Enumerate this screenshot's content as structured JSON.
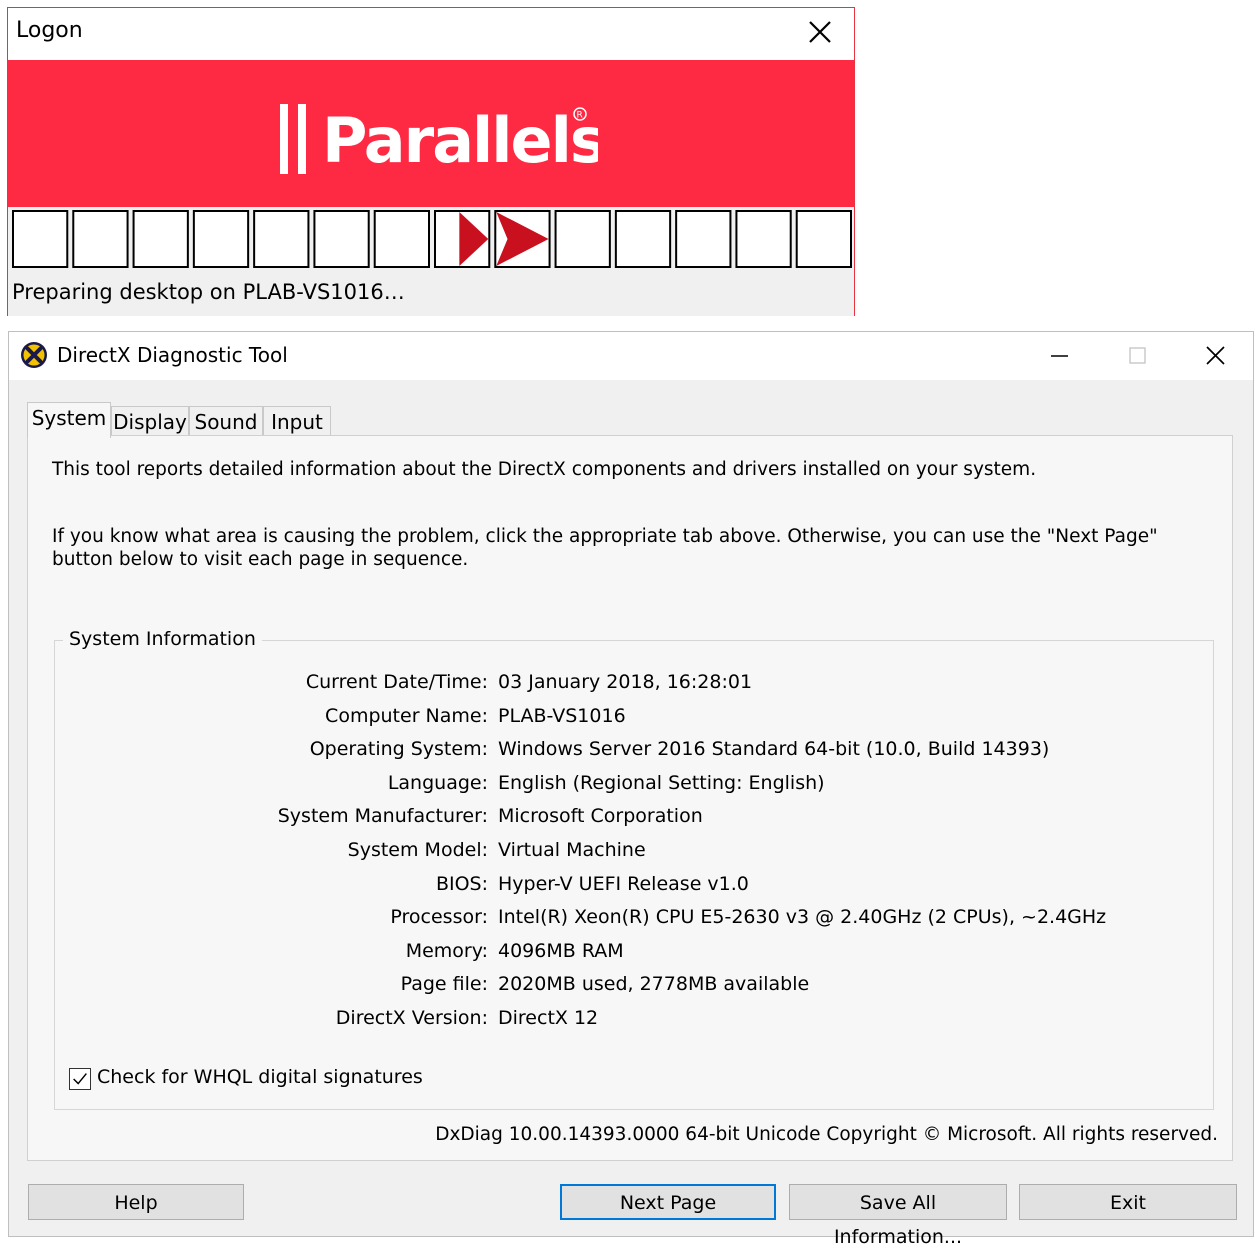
{
  "logon": {
    "title": "Logon",
    "brand": "Parallels",
    "status": "Preparing desktop on PLAB-VS1016…",
    "progress": {
      "segments": 14,
      "active": [
        7,
        8
      ]
    }
  },
  "dxdiag": {
    "title": "DirectX Diagnostic Tool",
    "tabs": [
      "System",
      "Display",
      "Sound",
      "Input"
    ],
    "active_tab": "System",
    "intro1": "This tool reports detailed information about the DirectX components and drivers installed on your system.",
    "intro2": "If you know what area is causing the problem, click the appropriate tab above.  Otherwise, you can use the \"Next Page\" button below to visit each page in sequence.",
    "system_info": {
      "legend": "System Information",
      "rows": [
        {
          "label": "Current Date/Time:",
          "value": "03 January 2018, 16:28:01"
        },
        {
          "label": "Computer Name:",
          "value": "PLAB-VS1016"
        },
        {
          "label": "Operating System:",
          "value": "Windows Server 2016 Standard 64-bit (10.0, Build 14393)"
        },
        {
          "label": "Language:",
          "value": "English (Regional Setting: English)"
        },
        {
          "label": "System Manufacturer:",
          "value": "Microsoft Corporation"
        },
        {
          "label": "System Model:",
          "value": "Virtual Machine"
        },
        {
          "label": "BIOS:",
          "value": "Hyper-V UEFI Release v1.0"
        },
        {
          "label": "Processor:",
          "value": "Intel(R) Xeon(R) CPU E5-2630 v3 @ 2.40GHz (2 CPUs), ~2.4GHz"
        },
        {
          "label": "Memory:",
          "value": "4096MB RAM"
        },
        {
          "label": "Page file:",
          "value": "2020MB used, 2778MB available"
        },
        {
          "label": "DirectX Version:",
          "value": "DirectX 12"
        }
      ]
    },
    "whql": {
      "label": "Check for WHQL digital signatures",
      "checked": true
    },
    "copyright": "DxDiag 10.00.14393.0000 64-bit Unicode  Copyright © Microsoft. All rights reserved.",
    "buttons": {
      "help": "Help",
      "next": "Next Page",
      "save": "Save All Information...",
      "exit": "Exit"
    }
  },
  "colors": {
    "parallels_red": "#fe2a44",
    "progress_red": "#c8101e",
    "focus_blue": "#0078d7"
  }
}
